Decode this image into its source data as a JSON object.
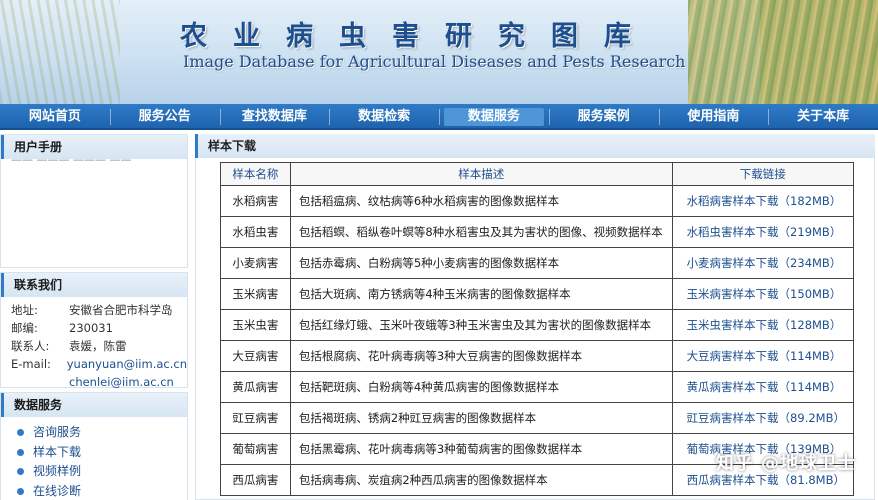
{
  "banner": {
    "title_cn": "农业病虫害研究图库",
    "title_en": "Image Database for Agricultural Diseases and Pests Research"
  },
  "nav": {
    "items": [
      {
        "label": "网站首页"
      },
      {
        "label": "服务公告"
      },
      {
        "label": "查找数据库"
      },
      {
        "label": "数据检索"
      },
      {
        "label": "数据服务"
      },
      {
        "label": "服务案例"
      },
      {
        "label": "使用指南"
      },
      {
        "label": "关于本库"
      }
    ],
    "active_index": 4
  },
  "sidebar": {
    "user_manual": {
      "title": "用户手册"
    },
    "contact": {
      "title": "联系我们",
      "rows": [
        {
          "label": "地址:",
          "value": "安徽省合肥市科学岛"
        },
        {
          "label": "邮编:",
          "value": "230031"
        },
        {
          "label": "联系人:",
          "value": "袁媛，陈雷"
        },
        {
          "label": "E-mail:",
          "value": "yuanyuan@iim.ac.cn"
        },
        {
          "label": "",
          "value": "chenlei@iim.ac.cn"
        }
      ]
    },
    "data_service": {
      "title": "数据服务",
      "items": [
        {
          "label": "咨询服务"
        },
        {
          "label": "样本下载"
        },
        {
          "label": "视频样例"
        },
        {
          "label": "在线诊断"
        }
      ]
    }
  },
  "main": {
    "title": "样本下载",
    "table": {
      "headers": [
        "样本名称",
        "样本描述",
        "下载链接"
      ],
      "rows": [
        {
          "name": "水稻病害",
          "desc": "包括稻瘟病、纹枯病等6种水稻病害的图像数据样本",
          "link": "水稻病害样本下载（182MB）"
        },
        {
          "name": "水稻虫害",
          "desc": "包括稻螟、稻纵卷叶螟等8种水稻害虫及其为害状的图像、视频数据样本",
          "link": "水稻虫害样本下载（219MB）"
        },
        {
          "name": "小麦病害",
          "desc": "包括赤霉病、白粉病等5种小麦病害的图像数据样本",
          "link": "小麦病害样本下载（234MB）"
        },
        {
          "name": "玉米病害",
          "desc": "包括大斑病、南方锈病等4种玉米病害的图像数据样本",
          "link": "玉米病害样本下载（150MB）"
        },
        {
          "name": "玉米虫害",
          "desc": "包括红缘灯蛾、玉米叶夜蛾等3种玉米害虫及其为害状的图像数据样本",
          "link": "玉米虫害样本下载（128MB）"
        },
        {
          "name": "大豆病害",
          "desc": "包括根腐病、花叶病毒病等3种大豆病害的图像数据样本",
          "link": "大豆病害样本下载（114MB）"
        },
        {
          "name": "黄瓜病害",
          "desc": "包括靶斑病、白粉病等4种黄瓜病害的图像数据样本",
          "link": "黄瓜病害样本下载（114MB）"
        },
        {
          "name": "豇豆病害",
          "desc": "包括褐斑病、锈病2种豇豆病害的图像数据样本",
          "link": "豇豆病害样本下载（89.2MB）"
        },
        {
          "name": "葡萄病害",
          "desc": "包括黑霉病、花叶病毒病等3种葡萄病害的图像数据样本",
          "link": "葡萄病害样本下载（139MB）"
        },
        {
          "name": "西瓜病害",
          "desc": "包括病毒病、炭疽病2种西瓜病害的图像数据样本",
          "link": "西瓜病害样本下载（81.8MB）"
        }
      ]
    }
  },
  "watermark": "知乎 @地球卫士"
}
